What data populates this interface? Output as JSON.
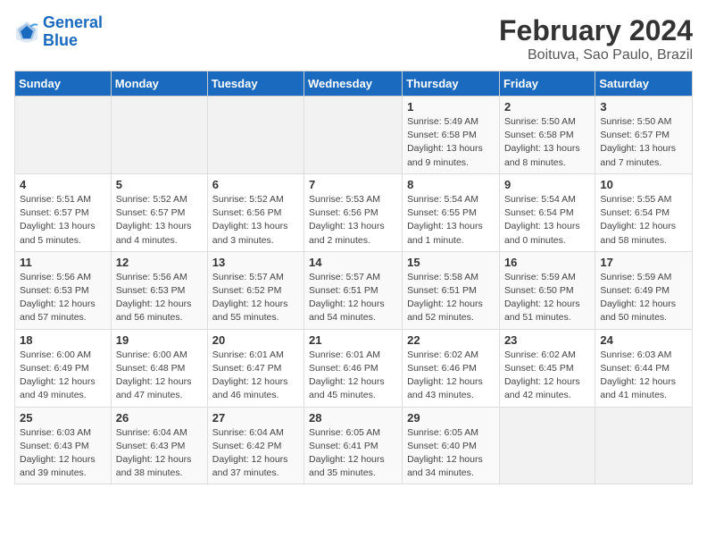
{
  "header": {
    "logo_line1": "General",
    "logo_line2": "Blue",
    "title": "February 2024",
    "subtitle": "Boituva, Sao Paulo, Brazil"
  },
  "days_of_week": [
    "Sunday",
    "Monday",
    "Tuesday",
    "Wednesday",
    "Thursday",
    "Friday",
    "Saturday"
  ],
  "weeks": [
    [
      {
        "day": "",
        "info": ""
      },
      {
        "day": "",
        "info": ""
      },
      {
        "day": "",
        "info": ""
      },
      {
        "day": "",
        "info": ""
      },
      {
        "day": "1",
        "info": "Sunrise: 5:49 AM\nSunset: 6:58 PM\nDaylight: 13 hours\nand 9 minutes."
      },
      {
        "day": "2",
        "info": "Sunrise: 5:50 AM\nSunset: 6:58 PM\nDaylight: 13 hours\nand 8 minutes."
      },
      {
        "day": "3",
        "info": "Sunrise: 5:50 AM\nSunset: 6:57 PM\nDaylight: 13 hours\nand 7 minutes."
      }
    ],
    [
      {
        "day": "4",
        "info": "Sunrise: 5:51 AM\nSunset: 6:57 PM\nDaylight: 13 hours\nand 5 minutes."
      },
      {
        "day": "5",
        "info": "Sunrise: 5:52 AM\nSunset: 6:57 PM\nDaylight: 13 hours\nand 4 minutes."
      },
      {
        "day": "6",
        "info": "Sunrise: 5:52 AM\nSunset: 6:56 PM\nDaylight: 13 hours\nand 3 minutes."
      },
      {
        "day": "7",
        "info": "Sunrise: 5:53 AM\nSunset: 6:56 PM\nDaylight: 13 hours\nand 2 minutes."
      },
      {
        "day": "8",
        "info": "Sunrise: 5:54 AM\nSunset: 6:55 PM\nDaylight: 13 hours\nand 1 minute."
      },
      {
        "day": "9",
        "info": "Sunrise: 5:54 AM\nSunset: 6:54 PM\nDaylight: 13 hours\nand 0 minutes."
      },
      {
        "day": "10",
        "info": "Sunrise: 5:55 AM\nSunset: 6:54 PM\nDaylight: 12 hours\nand 58 minutes."
      }
    ],
    [
      {
        "day": "11",
        "info": "Sunrise: 5:56 AM\nSunset: 6:53 PM\nDaylight: 12 hours\nand 57 minutes."
      },
      {
        "day": "12",
        "info": "Sunrise: 5:56 AM\nSunset: 6:53 PM\nDaylight: 12 hours\nand 56 minutes."
      },
      {
        "day": "13",
        "info": "Sunrise: 5:57 AM\nSunset: 6:52 PM\nDaylight: 12 hours\nand 55 minutes."
      },
      {
        "day": "14",
        "info": "Sunrise: 5:57 AM\nSunset: 6:51 PM\nDaylight: 12 hours\nand 54 minutes."
      },
      {
        "day": "15",
        "info": "Sunrise: 5:58 AM\nSunset: 6:51 PM\nDaylight: 12 hours\nand 52 minutes."
      },
      {
        "day": "16",
        "info": "Sunrise: 5:59 AM\nSunset: 6:50 PM\nDaylight: 12 hours\nand 51 minutes."
      },
      {
        "day": "17",
        "info": "Sunrise: 5:59 AM\nSunset: 6:49 PM\nDaylight: 12 hours\nand 50 minutes."
      }
    ],
    [
      {
        "day": "18",
        "info": "Sunrise: 6:00 AM\nSunset: 6:49 PM\nDaylight: 12 hours\nand 49 minutes."
      },
      {
        "day": "19",
        "info": "Sunrise: 6:00 AM\nSunset: 6:48 PM\nDaylight: 12 hours\nand 47 minutes."
      },
      {
        "day": "20",
        "info": "Sunrise: 6:01 AM\nSunset: 6:47 PM\nDaylight: 12 hours\nand 46 minutes."
      },
      {
        "day": "21",
        "info": "Sunrise: 6:01 AM\nSunset: 6:46 PM\nDaylight: 12 hours\nand 45 minutes."
      },
      {
        "day": "22",
        "info": "Sunrise: 6:02 AM\nSunset: 6:46 PM\nDaylight: 12 hours\nand 43 minutes."
      },
      {
        "day": "23",
        "info": "Sunrise: 6:02 AM\nSunset: 6:45 PM\nDaylight: 12 hours\nand 42 minutes."
      },
      {
        "day": "24",
        "info": "Sunrise: 6:03 AM\nSunset: 6:44 PM\nDaylight: 12 hours\nand 41 minutes."
      }
    ],
    [
      {
        "day": "25",
        "info": "Sunrise: 6:03 AM\nSunset: 6:43 PM\nDaylight: 12 hours\nand 39 minutes."
      },
      {
        "day": "26",
        "info": "Sunrise: 6:04 AM\nSunset: 6:43 PM\nDaylight: 12 hours\nand 38 minutes."
      },
      {
        "day": "27",
        "info": "Sunrise: 6:04 AM\nSunset: 6:42 PM\nDaylight: 12 hours\nand 37 minutes."
      },
      {
        "day": "28",
        "info": "Sunrise: 6:05 AM\nSunset: 6:41 PM\nDaylight: 12 hours\nand 35 minutes."
      },
      {
        "day": "29",
        "info": "Sunrise: 6:05 AM\nSunset: 6:40 PM\nDaylight: 12 hours\nand 34 minutes."
      },
      {
        "day": "",
        "info": ""
      },
      {
        "day": "",
        "info": ""
      }
    ]
  ]
}
